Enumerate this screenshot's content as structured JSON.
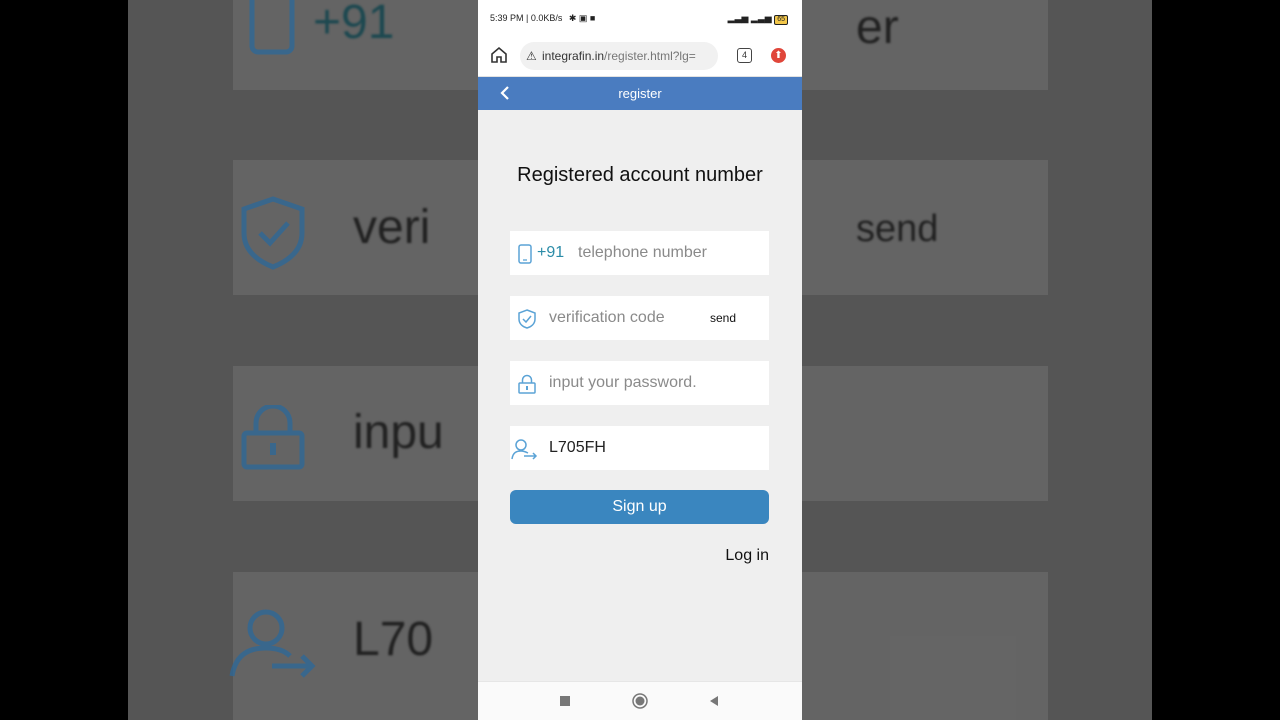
{
  "status_bar": {
    "time_speed": "5:39 PM | 0.0KB/s",
    "battery": "65"
  },
  "browser": {
    "url_host": "integrafin.in",
    "url_path": "/register.html?lg=",
    "tab_count": "4"
  },
  "appbar": {
    "title": "register"
  },
  "form": {
    "heading": "Registered account number",
    "phone_prefix": "+91",
    "phone_placeholder": "telephone number",
    "code_placeholder": "verification code",
    "send_label": "send",
    "password_placeholder": "input your password.",
    "invite_code_value": "L705FH",
    "signup_label": "Sign up",
    "login_label": "Log in"
  },
  "background_zoom": {
    "prefix": "+91",
    "code_fragment": "veri",
    "send_fragment": "send",
    "title_fragment": "er",
    "password_fragment": "inpu",
    "invite_fragment": "L70"
  },
  "colors": {
    "appbar": "#4a7cc0",
    "signup_button": "#3a86bf",
    "icon_blue": "#5ba3d6",
    "prefix_text": "#2b8ca8"
  }
}
